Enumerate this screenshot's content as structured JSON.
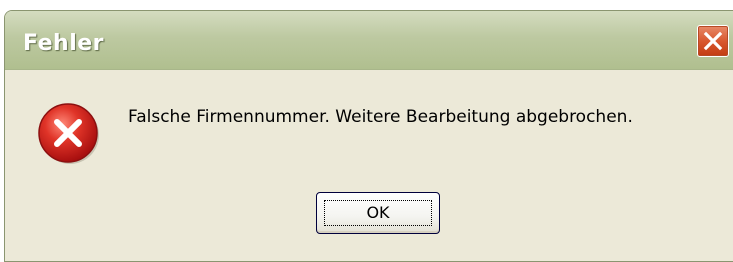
{
  "dialog": {
    "title": "Fehler",
    "message": "Falsche Firmennummer. Weitere Bearbeitung abgebrochen.",
    "icon": "error-icon",
    "ok_label": "OK",
    "close_icon": "close-icon"
  },
  "colors": {
    "titlebar": "#b8c59a",
    "body": "#ece9d8",
    "close_button": "#d9582f",
    "error_icon": "#d21f1f"
  }
}
